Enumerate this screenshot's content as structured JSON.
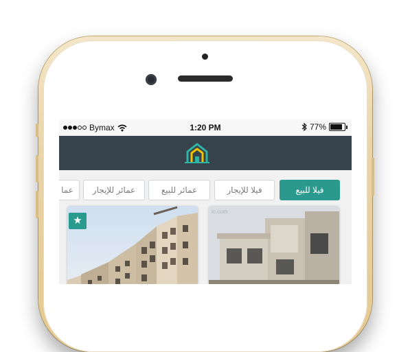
{
  "status_bar": {
    "carrier": "Bymax",
    "time": "1:20 PM",
    "battery": "77%",
    "battery_level": 0.77
  },
  "tabs": [
    {
      "label": "فيلا للبيع",
      "active": true
    },
    {
      "label": "فيلا للإيجار",
      "active": false
    },
    {
      "label": "عمائر للبيع",
      "active": false
    },
    {
      "label": "عمائر للإيجار",
      "active": false
    },
    {
      "label": "عما",
      "active": false
    }
  ],
  "listings": [
    {
      "featured": true,
      "icon": "star-icon",
      "badge_symbol": "★"
    },
    {
      "featured": false,
      "watermark": "ic.com"
    }
  ],
  "colors": {
    "app_bar": "#36434d",
    "accent": "#2b9a8e",
    "logo_yellow": "#f2c200",
    "logo_teal": "#2fb5a3"
  },
  "icons": {
    "logo": "house-logo-icon",
    "wifi": "wifi-icon",
    "bluetooth": "bluetooth-icon",
    "battery": "battery-icon"
  }
}
